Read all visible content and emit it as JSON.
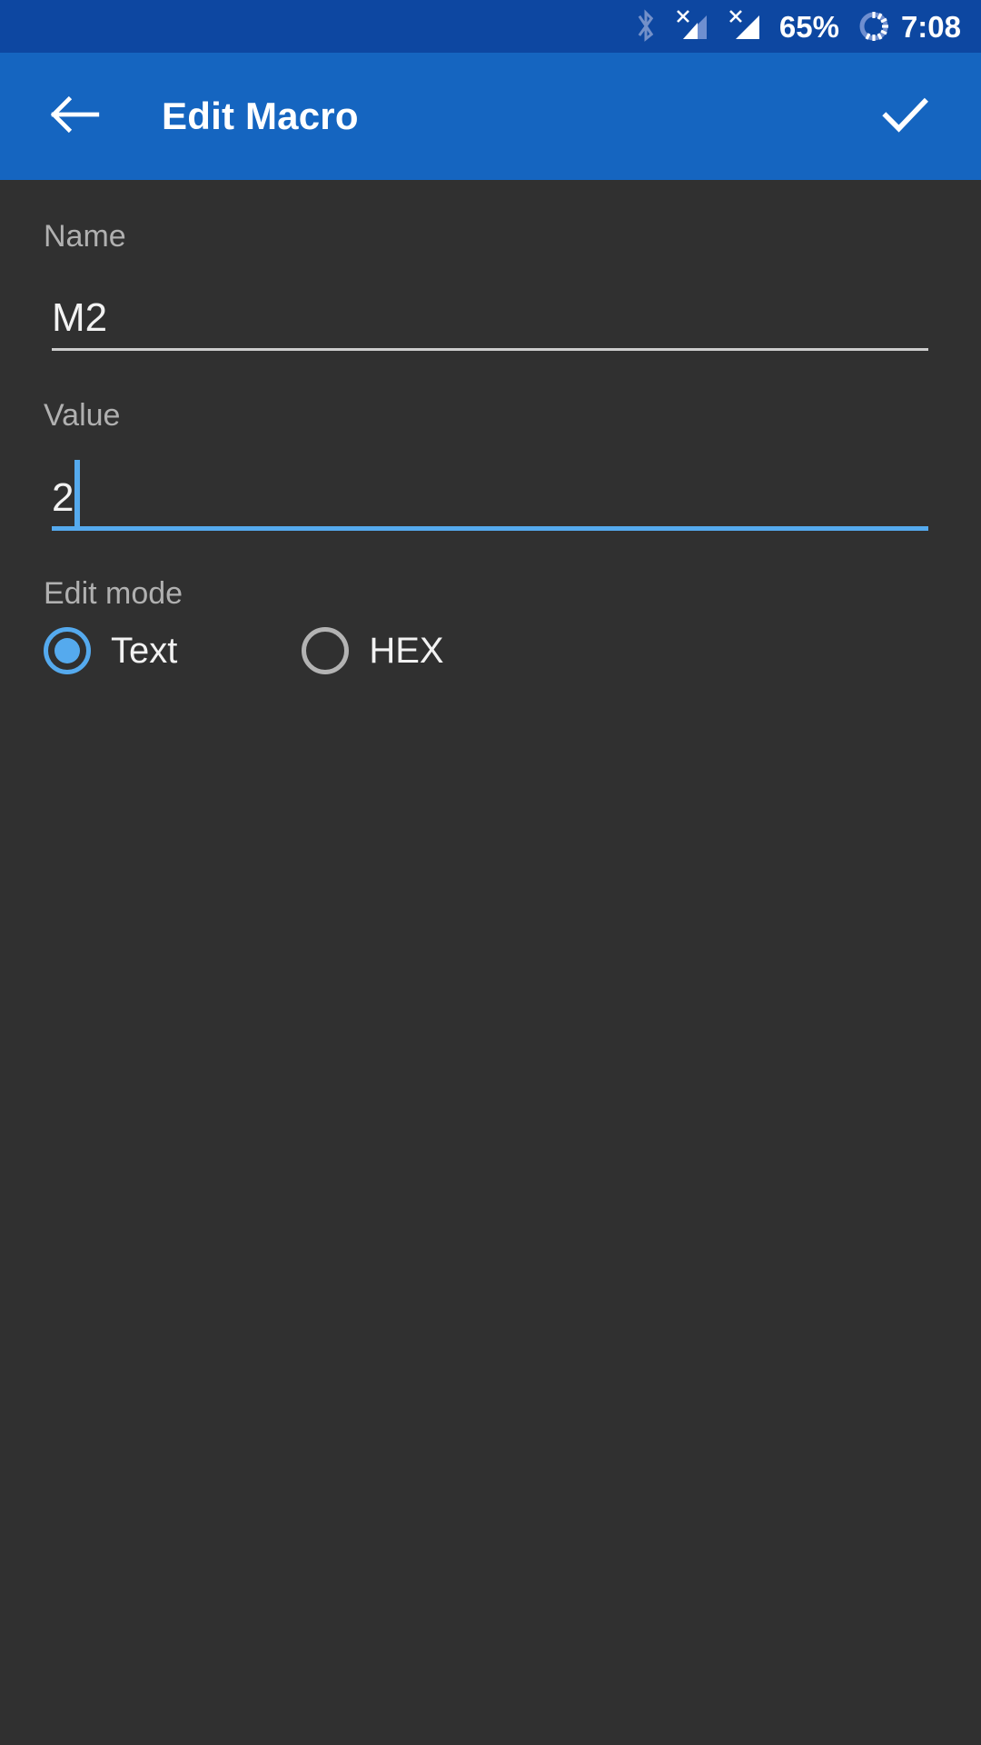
{
  "status_bar": {
    "background": "#0d47a1",
    "icons": [
      {
        "name": "bluetooth-icon",
        "label": "Bluetooth"
      },
      {
        "name": "signal-no-service-sim1-icon",
        "label": "No service SIM 1"
      },
      {
        "name": "signal-no-service-sim2-icon",
        "label": "No service SIM 2"
      }
    ],
    "battery_percent": "65%",
    "battery_icon": "battery-charging-ring-icon",
    "clock": "7:08"
  },
  "toolbar": {
    "background": "#1565c0",
    "back_icon": "arrow-back-icon",
    "title": "Edit Macro",
    "confirm_icon": "check-icon"
  },
  "form": {
    "name": {
      "label": "Name",
      "value": "M2",
      "focused": false,
      "underline_color": "#cccccc"
    },
    "value": {
      "label": "Value",
      "value": "2",
      "focused": true,
      "underline_color": "#55aaee",
      "caret": true
    },
    "edit_mode": {
      "label": "Edit mode",
      "selected": "Text",
      "options": [
        {
          "label": "Text",
          "selected": true
        },
        {
          "label": "HEX",
          "selected": false
        }
      ],
      "accent_color": "#55aaee",
      "inactive_color": "#b3b3b3"
    }
  },
  "theme": {
    "background": "#303030",
    "label_color": "#b0b0b0",
    "text_color": "#f2f2f2",
    "accent": "#55aaee"
  }
}
